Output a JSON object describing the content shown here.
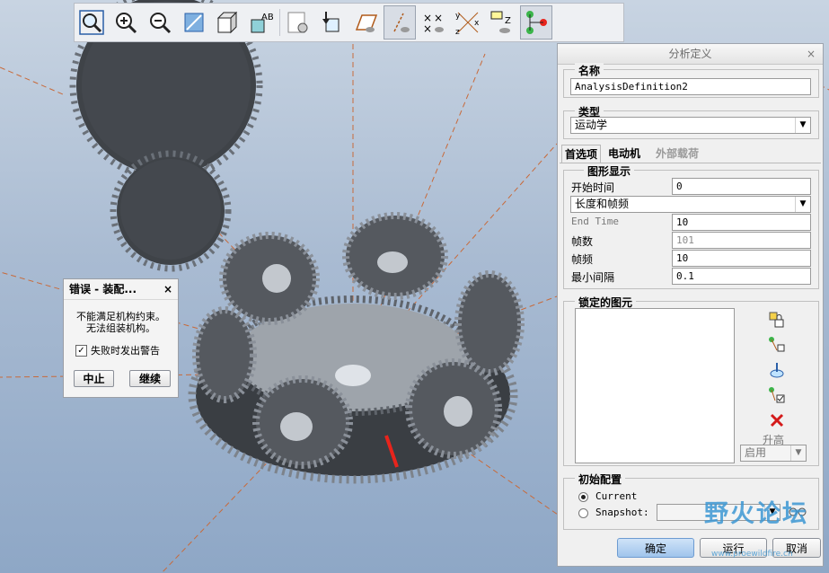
{
  "toolbar": {
    "buttons": [
      {
        "icon": "zoom-fit-icon"
      },
      {
        "icon": "zoom-in-icon"
      },
      {
        "icon": "zoom-out-icon"
      },
      {
        "icon": "repaint-icon"
      },
      {
        "icon": "view-orientation-cube-icon"
      },
      {
        "icon": "display-style-icon",
        "text": "AB"
      },
      {
        "icon": "saved-views-icon"
      },
      {
        "icon": "datum-display-icon"
      },
      {
        "icon": "plane-display-icon"
      },
      {
        "icon": "axis-display-icon"
      },
      {
        "icon": "point-display-icon"
      },
      {
        "icon": "csys-display-icon",
        "text": "yx z"
      },
      {
        "icon": "annotation-display-icon",
        "text": "Z"
      },
      {
        "icon": "connection-display-icon"
      }
    ]
  },
  "error_dialog": {
    "title": "错误 - 装配...",
    "close": "×",
    "message_line1": "不能满足机构约束。",
    "message_line2": "无法组装机构。",
    "checkbox_label": "失败时发出警告",
    "checkbox_checked": true,
    "abort_button": "中止",
    "continue_button": "继续"
  },
  "analysis_dialog": {
    "title": "分析定义",
    "close": "×",
    "name_label": "名称",
    "name_value": "AnalysisDefinition2",
    "type_label": "类型",
    "type_value": "运动学",
    "tabs": [
      "首选项",
      "电动机",
      "外部载荷"
    ],
    "graph_display": {
      "label": "图形显示",
      "start_time_label": "开始时间",
      "start_time_value": "0",
      "mode_value": "长度和帧频",
      "end_time_label": "End Time",
      "end_time_value": "10",
      "frames_label": "帧数",
      "frames_value": "101",
      "frame_rate_label": "帧频",
      "frame_rate_value": "10",
      "min_interval_label": "最小间隔",
      "min_interval_value": "0.1"
    },
    "locked_entities": {
      "label": "锁定的图元",
      "raise_label": "升高",
      "enable_value": "启用"
    },
    "initial_config": {
      "label": "初始配置",
      "current_label": "Current",
      "snapshot_label": "Snapshot:"
    },
    "ok_button": "确定",
    "run_button": "运行",
    "cancel_button": "取消"
  },
  "watermark": {
    "text": "野火论坛",
    "url": "www.proewildfire.cn"
  },
  "colors": {
    "accent": "#6d9bd1",
    "gear": "#4a4e54",
    "highlight": "#e8241c",
    "datum": "#c86a3a"
  }
}
